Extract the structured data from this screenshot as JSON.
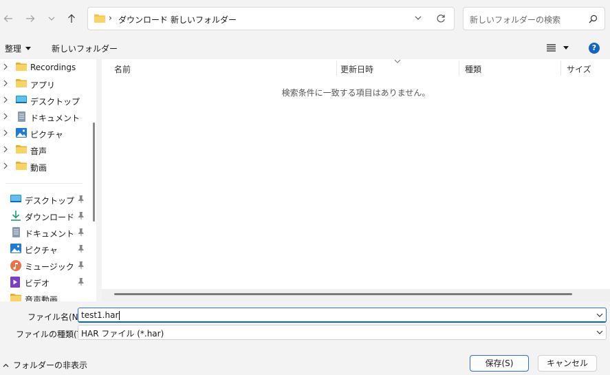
{
  "address": {
    "crumbs": [
      "ダウンロード",
      "新しいフォルダー"
    ]
  },
  "search": {
    "placeholder": "新しいフォルダーの検索"
  },
  "toolbar": {
    "organize": "整理",
    "new_folder": "新しいフォルダー",
    "help": "?"
  },
  "nav": {
    "tree": [
      {
        "label": "Recordings",
        "icon": "folder-icon"
      },
      {
        "label": "アプリ",
        "icon": "folder-icon"
      },
      {
        "label": "デスクトップ",
        "icon": "desktop-icon"
      },
      {
        "label": "ドキュメント",
        "icon": "document-icon"
      },
      {
        "label": "ピクチャ",
        "icon": "picture-icon"
      },
      {
        "label": "音声",
        "icon": "folder-icon"
      },
      {
        "label": "動画",
        "icon": "folder-icon"
      }
    ],
    "quick": [
      {
        "label": "デスクトップ",
        "icon": "desktop-icon"
      },
      {
        "label": "ダウンロード",
        "icon": "download-icon"
      },
      {
        "label": "ドキュメント",
        "icon": "document-icon"
      },
      {
        "label": "ピクチャ",
        "icon": "picture-icon"
      },
      {
        "label": "ミュージック",
        "icon": "music-icon"
      },
      {
        "label": "ビデオ",
        "icon": "video-icon"
      },
      {
        "label": "音声動画",
        "icon": "folder-icon"
      }
    ]
  },
  "columns": {
    "name": "名前",
    "modified": "更新日時",
    "type": "種類",
    "size": "サイズ"
  },
  "empty_message": "検索条件に一致する項目はありません。",
  "file_name": {
    "label": "ファイル名(N):",
    "value": "test1.har"
  },
  "file_type": {
    "label": "ファイルの種類(T):",
    "value": "HAR ファイル (*.har)"
  },
  "hide_folders": "フォルダーの非表示",
  "buttons": {
    "save": "保存(S)",
    "cancel": "キャンセル"
  },
  "colors": {
    "accent": "#0067c0",
    "folder": "#f4c242",
    "help": "#1565c0"
  }
}
